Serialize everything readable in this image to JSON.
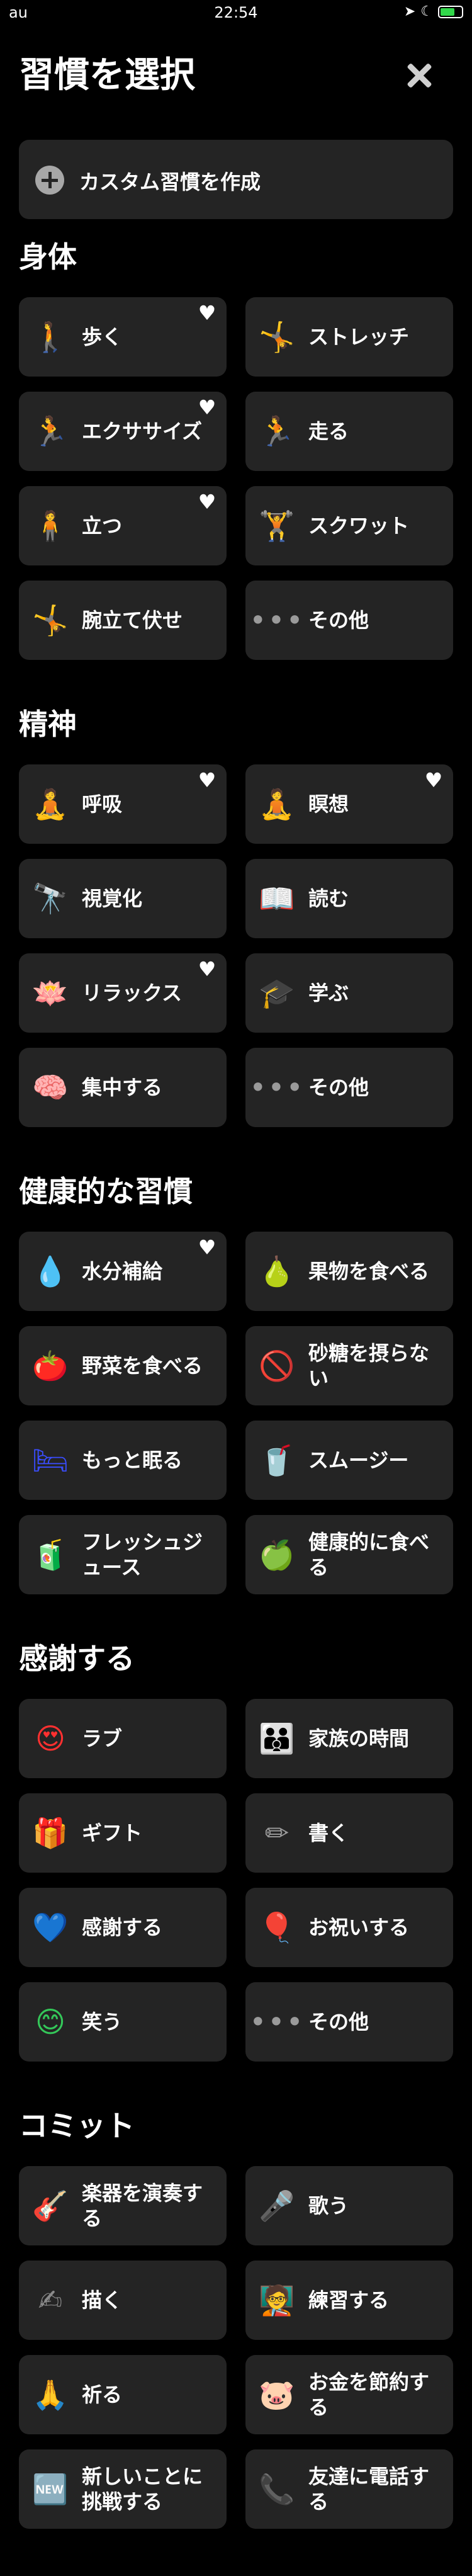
{
  "status_bar": {
    "carrier": "au",
    "time": "22:54"
  },
  "header": {
    "title": "習慣を選択"
  },
  "custom_button": {
    "label": "カスタム習慣を作成"
  },
  "sections": [
    {
      "title": "身体",
      "items": [
        {
          "label": "歩く",
          "icon": "walking-person-icon",
          "glyph": "🚶",
          "color": "#ff7a2f",
          "favorite": true
        },
        {
          "label": "ストレッチ",
          "icon": "stretch-icon",
          "glyph": "🤸",
          "color": "#6f57ff",
          "favorite": false
        },
        {
          "label": "エクササイズ",
          "icon": "exercise-icon",
          "glyph": "🏃",
          "color": "#34c759",
          "favorite": true
        },
        {
          "label": "走る",
          "icon": "running-icon",
          "glyph": "🏃",
          "color": "#ff3b5c",
          "favorite": false
        },
        {
          "label": "立つ",
          "icon": "standing-person-icon",
          "glyph": "🧍",
          "color": "#8a8fd8",
          "favorite": true
        },
        {
          "label": "スクワット",
          "icon": "squat-icon",
          "glyph": "🏋",
          "color": "#4d6bff",
          "favorite": false
        },
        {
          "label": "腕立て伏せ",
          "icon": "pushup-icon",
          "glyph": "🤸",
          "color": "#ff5a1f",
          "favorite": false
        },
        {
          "label": "その他",
          "icon": "more-icon",
          "glyph": "•••",
          "color": "#9a9a9a",
          "favorite": false
        }
      ]
    },
    {
      "title": "精神",
      "items": [
        {
          "label": "呼吸",
          "icon": "breath-icon",
          "glyph": "🧘",
          "color": "#16c7c7",
          "favorite": true
        },
        {
          "label": "瞑想",
          "icon": "meditation-icon",
          "glyph": "🧘",
          "color": "#2fd67a",
          "favorite": true
        },
        {
          "label": "視覚化",
          "icon": "binoculars-icon",
          "glyph": "🔭",
          "color": "#6ad04a",
          "favorite": false
        },
        {
          "label": "読む",
          "icon": "reading-icon",
          "glyph": "📖",
          "color": "#c77a3f",
          "favorite": false
        },
        {
          "label": "リラックス",
          "icon": "lotus-icon",
          "glyph": "🪷",
          "color": "#ff3b6b",
          "favorite": true
        },
        {
          "label": "学ぶ",
          "icon": "graduation-cap-icon",
          "glyph": "🎓",
          "color": "#3f7bff",
          "favorite": false
        },
        {
          "label": "集中する",
          "icon": "brain-head-icon",
          "glyph": "🧠",
          "color": "#6e6e6e",
          "favorite": false
        },
        {
          "label": "その他",
          "icon": "more-icon",
          "glyph": "•••",
          "color": "#9a9a9a",
          "favorite": false
        }
      ]
    },
    {
      "title": "健康的な習慣",
      "items": [
        {
          "label": "水分補給",
          "icon": "water-drop-icon",
          "glyph": "💧",
          "color": "#2f8cff",
          "favorite": true
        },
        {
          "label": "果物を食べる",
          "icon": "pear-icon",
          "glyph": "🍐",
          "color": "#9bd14a",
          "favorite": false
        },
        {
          "label": "野菜を食べる",
          "icon": "tomato-icon",
          "glyph": "🍅",
          "color": "#ff3030",
          "favorite": false
        },
        {
          "label": "砂糖を摂らない",
          "icon": "no-sugar-icon",
          "glyph": "🚫",
          "color": "#ff3030",
          "favorite": false
        },
        {
          "label": "もっと眠る",
          "icon": "bed-icon",
          "glyph": "🛏",
          "color": "#3a4dff",
          "favorite": false
        },
        {
          "label": "スムージー",
          "icon": "blender-icon",
          "glyph": "🥤",
          "color": "#34c759",
          "favorite": false
        },
        {
          "label": "フレッシュジュース",
          "icon": "juice-icon",
          "glyph": "🧃",
          "color": "#ff7a2f",
          "favorite": false
        },
        {
          "label": "健康的に食べる",
          "icon": "apple-icon",
          "glyph": "🍏",
          "color": "#4cd964",
          "favorite": false
        }
      ]
    },
    {
      "title": "感謝する",
      "items": [
        {
          "label": "ラブ",
          "icon": "love-face-icon",
          "glyph": "😍",
          "color": "#ff3030",
          "favorite": false
        },
        {
          "label": "家族の時間",
          "icon": "family-icon",
          "glyph": "👪",
          "color": "#34c759",
          "favorite": false
        },
        {
          "label": "ギフト",
          "icon": "gift-icon",
          "glyph": "🎁",
          "color": "#ff3b7a",
          "favorite": false
        },
        {
          "label": "書く",
          "icon": "pencil-icon",
          "glyph": "✏",
          "color": "#9a9a9a",
          "favorite": false
        },
        {
          "label": "感謝する",
          "icon": "heart-check-icon",
          "glyph": "💙",
          "color": "#2f8cff",
          "favorite": false
        },
        {
          "label": "お祝いする",
          "icon": "balloons-icon",
          "glyph": "🎈",
          "color": "#e040fb",
          "favorite": false
        },
        {
          "label": "笑う",
          "icon": "smile-icon",
          "glyph": "😊",
          "color": "#34c759",
          "favorite": false
        },
        {
          "label": "その他",
          "icon": "more-icon",
          "glyph": "•••",
          "color": "#9a9a9a",
          "favorite": false
        }
      ]
    },
    {
      "title": "コミット",
      "items": [
        {
          "label": "楽器を演奏する",
          "icon": "guitar-icon",
          "glyph": "🎸",
          "color": "#ff7a2f",
          "favorite": false
        },
        {
          "label": "歌う",
          "icon": "sing-icon",
          "glyph": "🎤",
          "color": "#6f6fd8",
          "favorite": false
        },
        {
          "label": "描く",
          "icon": "draw-hand-icon",
          "glyph": "✍",
          "color": "#8a8a8a",
          "favorite": false
        },
        {
          "label": "練習する",
          "icon": "practice-icon",
          "glyph": "🧑‍🏫",
          "color": "#34c759",
          "favorite": false
        },
        {
          "label": "祈る",
          "icon": "praying-hands-icon",
          "glyph": "🙏",
          "color": "#16c7c7",
          "favorite": false
        },
        {
          "label": "お金を節約する",
          "icon": "piggy-bank-icon",
          "glyph": "🐷",
          "color": "#6ad04a",
          "favorite": false
        },
        {
          "label": "新しいことに挑戦する",
          "icon": "new-badge-icon",
          "glyph": "🆕",
          "color": "#ff3030",
          "favorite": false
        },
        {
          "label": "友達に電話する",
          "icon": "phone-icon",
          "glyph": "📞",
          "color": "#2f8cff",
          "favorite": false
        }
      ]
    }
  ]
}
